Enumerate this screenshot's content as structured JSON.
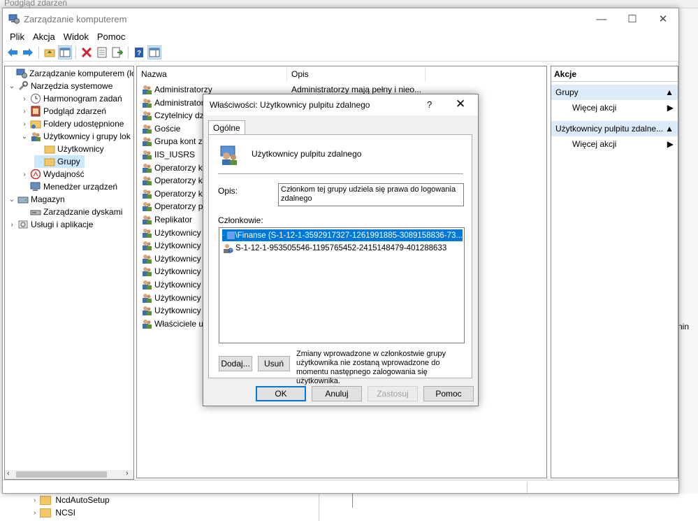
{
  "background": {
    "top_title": "Podgląd zdarzeń",
    "right_text": "nin",
    "folders": [
      {
        "label": "NcdAutoSetup"
      },
      {
        "label": "NCSI"
      }
    ]
  },
  "window": {
    "title": "Zarządzanie komputerem",
    "controls": {
      "minimize": "—",
      "maximize": "☐",
      "close": "✕"
    }
  },
  "menu": [
    "Plik",
    "Akcja",
    "Widok",
    "Pomoc"
  ],
  "tree": [
    {
      "label": "Zarządzanie komputerem (loka",
      "exp": ""
    },
    {
      "label": "Narzędzia systemowe",
      "exp": "⌄"
    },
    {
      "label": "Harmonogram zadań",
      "exp": "›"
    },
    {
      "label": "Podgląd zdarzeń",
      "exp": "›"
    },
    {
      "label": "Foldery udostępnione",
      "exp": "›"
    },
    {
      "label": "Użytkownicy i grupy lok",
      "exp": "⌄"
    },
    {
      "label": "Użytkownicy",
      "exp": ""
    },
    {
      "label": "Grupy",
      "exp": ""
    },
    {
      "label": "Wydajność",
      "exp": "›"
    },
    {
      "label": "Menedżer urządzeń",
      "exp": ""
    },
    {
      "label": "Magazyn",
      "exp": "⌄"
    },
    {
      "label": "Zarządzanie dyskami",
      "exp": ""
    },
    {
      "label": "Usługi i aplikacje",
      "exp": "›"
    }
  ],
  "list": {
    "columns": [
      "Nazwa",
      "Opis"
    ],
    "rows": [
      {
        "name": "Administratorzy",
        "desc": "Administratorzy mają pełny i nieo..."
      },
      {
        "name": "Administratorz",
        "desc": ""
      },
      {
        "name": "Czytelnicy dzie",
        "desc": ""
      },
      {
        "name": "Goście",
        "desc": ""
      },
      {
        "name": "Grupa kont zar",
        "desc": ""
      },
      {
        "name": "IIS_IUSRS",
        "desc": ""
      },
      {
        "name": "Operatorzy ko",
        "desc": ""
      },
      {
        "name": "Operatorzy ko",
        "desc": ""
      },
      {
        "name": "Operatorzy kry",
        "desc": ""
      },
      {
        "name": "Operatorzy po",
        "desc": ""
      },
      {
        "name": "Replikator",
        "desc": ""
      },
      {
        "name": "Użytkownicy",
        "desc": ""
      },
      {
        "name": "Użytkownicy D",
        "desc": ""
      },
      {
        "name": "Użytkownicy d",
        "desc": ""
      },
      {
        "name": "Użytkownicy n",
        "desc": ""
      },
      {
        "name": "Użytkownicy p",
        "desc": ""
      },
      {
        "name": "Użytkownicy z",
        "desc": ""
      },
      {
        "name": "Użytkownicy z",
        "desc": ""
      },
      {
        "name": "Właściciele urz",
        "desc": ""
      }
    ]
  },
  "actions": {
    "header": "Akcje",
    "sections": [
      {
        "title": "Grupy",
        "item": "Więcej akcji"
      },
      {
        "title": "Użytkownicy pulpitu zdalne...",
        "item": "Więcej akcji"
      }
    ]
  },
  "dialog": {
    "title": "Właściwości: Użytkownicy pulpitu zdalnego",
    "help": "?",
    "close": "✕",
    "tab": "Ogólne",
    "group_name": "Użytkownicy pulpitu zdalnego",
    "desc_label": "Opis:",
    "desc_value": "Członkom tej grupy udziela się prawa do logowania zdalnego",
    "members_label": "Członkowie:",
    "members": [
      {
        "text": "\\Finanse (S-1-12-1-3592917327-1261991885-3089158836-73..."
      },
      {
        "text": "S-1-12-1-953505546-1195765452-2415148479-401288633"
      }
    ],
    "add": "Dodaj...",
    "remove": "Usuń",
    "note": "Zmiany wprowadzone w członkostwie grupy użytkownika nie zostaną wprowadzone do momentu następnego zalogowania się użytkownika.",
    "ok": "OK",
    "cancel": "Anuluj",
    "apply": "Zastosuj",
    "help_btn": "Pomoc"
  }
}
